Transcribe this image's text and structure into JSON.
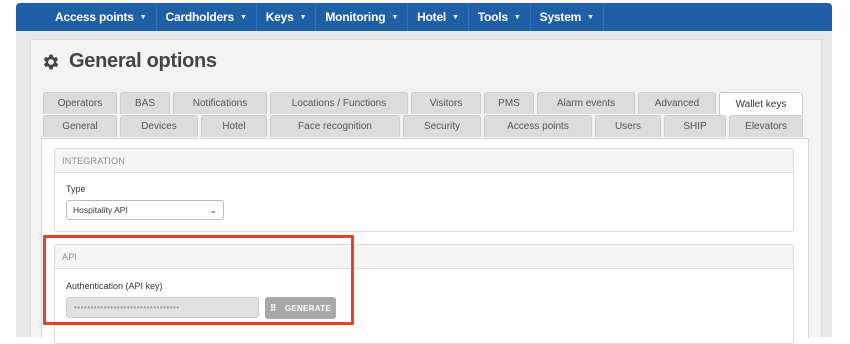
{
  "nav": {
    "items": [
      {
        "label": "Access points"
      },
      {
        "label": "Cardholders"
      },
      {
        "label": "Keys"
      },
      {
        "label": "Monitoring"
      },
      {
        "label": "Hotel"
      },
      {
        "label": "Tools"
      },
      {
        "label": "System"
      }
    ],
    "caret": "▼"
  },
  "page": {
    "title": "General options",
    "title_icon": "gear-icon"
  },
  "tabs": {
    "row1": [
      "Operators",
      "BAS",
      "Notifications",
      "Locations / Functions",
      "Visitors",
      "PMS",
      "Alarm events",
      "Advanced",
      "Wallet keys"
    ],
    "row2": [
      "General",
      "Devices",
      "Hotel",
      "Face recognition",
      "Security",
      "Access points",
      "Users",
      "SHIP",
      "Elevators"
    ],
    "active": "Wallet keys"
  },
  "integration": {
    "heading": "INTEGRATION",
    "type_label": "Type",
    "type_value": "Hospitality API",
    "chevron": "⌄"
  },
  "api": {
    "heading": "API",
    "auth_label": "Authentication (API key)",
    "api_key_masked": "••••••••••••••••••••••••••••••••",
    "generate_label": "GENERATE",
    "generate_icon": "keypad-icon"
  },
  "colors": {
    "nav_bg": "#1f5fa6",
    "highlight": "#e8402a",
    "button_gray": "#a8a8a8"
  }
}
